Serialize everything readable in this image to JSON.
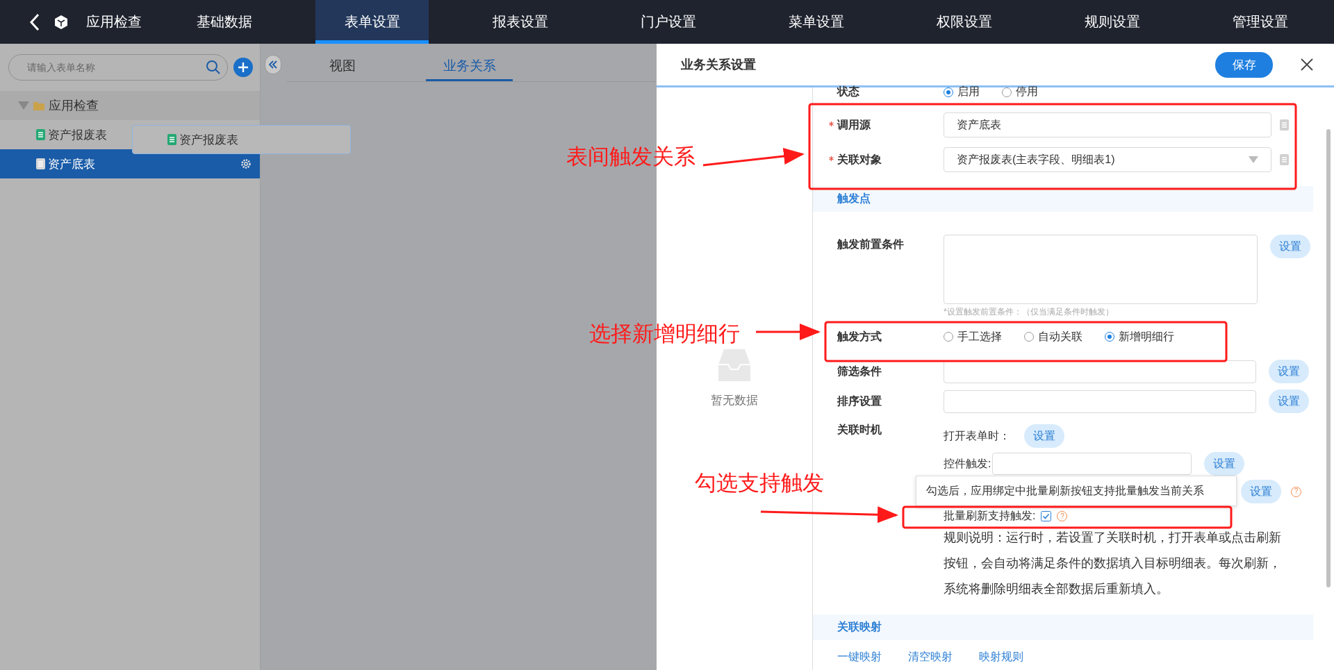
{
  "topbar": {
    "app_title": "应用检查",
    "nav": [
      {
        "label": "基础数据",
        "selected": false
      },
      {
        "label": "表单设置",
        "selected": true
      },
      {
        "label": "报表设置",
        "selected": false
      },
      {
        "label": "门户设置",
        "selected": false
      },
      {
        "label": "菜单设置",
        "selected": false
      },
      {
        "label": "权限设置",
        "selected": false
      },
      {
        "label": "规则设置",
        "selected": false
      },
      {
        "label": "管理设置",
        "selected": false
      }
    ]
  },
  "sidebar": {
    "search": {
      "placeholder": "请输入表单名称"
    },
    "tree": [
      {
        "label": "应用检查",
        "expanded": true,
        "children": [
          {
            "label": "资产报废表",
            "selected": false
          },
          {
            "label": "资产底表",
            "selected": true
          }
        ]
      }
    ]
  },
  "drag_ghost": {
    "label": "资产报废表"
  },
  "main": {
    "tabs": [
      {
        "label": "视图",
        "selected": false
      },
      {
        "label": "业务关系",
        "selected": true
      }
    ]
  },
  "panel": {
    "title": "业务关系设置",
    "save_button": "保存",
    "empty_text": "暂无数据",
    "status": {
      "label": "状态",
      "options": [
        {
          "label": "启用",
          "selected": true
        },
        {
          "label": "停用",
          "selected": false
        }
      ]
    },
    "source": {
      "label": "调用源",
      "required": true,
      "value": "资产底表"
    },
    "target": {
      "label": "关联对象",
      "required": true,
      "value": "资产报废表(主表字段、明细表1)"
    },
    "trigger_section": "触发点",
    "precondition": {
      "label": "触发前置条件",
      "button": "设置",
      "hint": "*设置触发前置条件：（仅当满足条件时触发）"
    },
    "trigger_mode": {
      "label": "触发方式",
      "options": [
        {
          "label": "手工选择",
          "selected": false
        },
        {
          "label": "自动关联",
          "selected": false
        },
        {
          "label": "新增明细行",
          "selected": true
        }
      ]
    },
    "filter": {
      "label": "筛选条件",
      "button": "设置"
    },
    "sort": {
      "label": "排序设置",
      "button": "设置"
    },
    "timing": {
      "label": "关联时机",
      "open_form": {
        "label": "打开表单时：",
        "button": "设置"
      },
      "control_trigger": {
        "label": "控件触发:",
        "button": "设置"
      },
      "third_button": "设置"
    },
    "third_help": "?",
    "batch": {
      "label": "批量刷新支持触发:",
      "checked": true,
      "help": "?",
      "tooltip": "勾选后，应用绑定中批量刷新按钮支持批量触发当前关系"
    },
    "rule_note": "规则说明：运行时，若设置了关联时机，打开表单或点击刷新按钮，会自动将满足条件的数据填入目标明细表。每次刷新，系统将删除明细表全部数据后重新填入。",
    "mapping_section": "关联映射",
    "mapping_links": [
      "一键映射",
      "清空映射",
      "映射规则"
    ]
  },
  "annotations": [
    "表间触发关系",
    "选择新增明细行",
    "勾选支持触发"
  ]
}
